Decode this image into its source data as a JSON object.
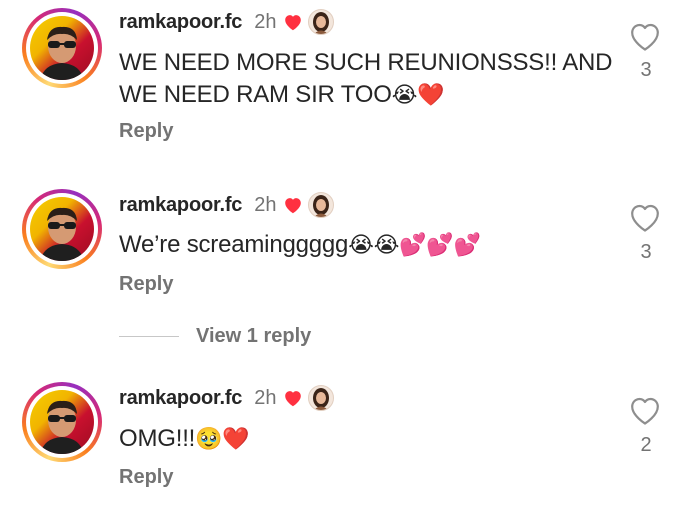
{
  "comments": [
    {
      "username": "ramkapoor.fc",
      "time": "2h",
      "text": "WE NEED MORE SUCH REUNIONSSS!! AND WE NEED RAM SIR TOO",
      "emojis": "😭❤️",
      "reply_label": "Reply",
      "like_count": "3"
    },
    {
      "username": "ramkapoor.fc",
      "time": "2h",
      "text": "We’re screaminggggg",
      "emojis": "😭😭💕💕💕",
      "reply_label": "Reply",
      "like_count": "3"
    },
    {
      "username": "ramkapoor.fc",
      "time": "2h",
      "text": "OMG!!!",
      "emojis": "🥹❤️",
      "reply_label": "Reply",
      "like_count": "2"
    }
  ],
  "view_replies_label": "View 1 reply",
  "icons": {
    "creator_liked": "red-heart-icon",
    "like": "heart-outline-icon"
  },
  "colors": {
    "creator_heart": "#ff3040",
    "secondary_text": "#737373",
    "primary_text": "#262626",
    "story_ring": [
      "#feda75",
      "#fa7e1e",
      "#d62976",
      "#962fbf"
    ]
  }
}
